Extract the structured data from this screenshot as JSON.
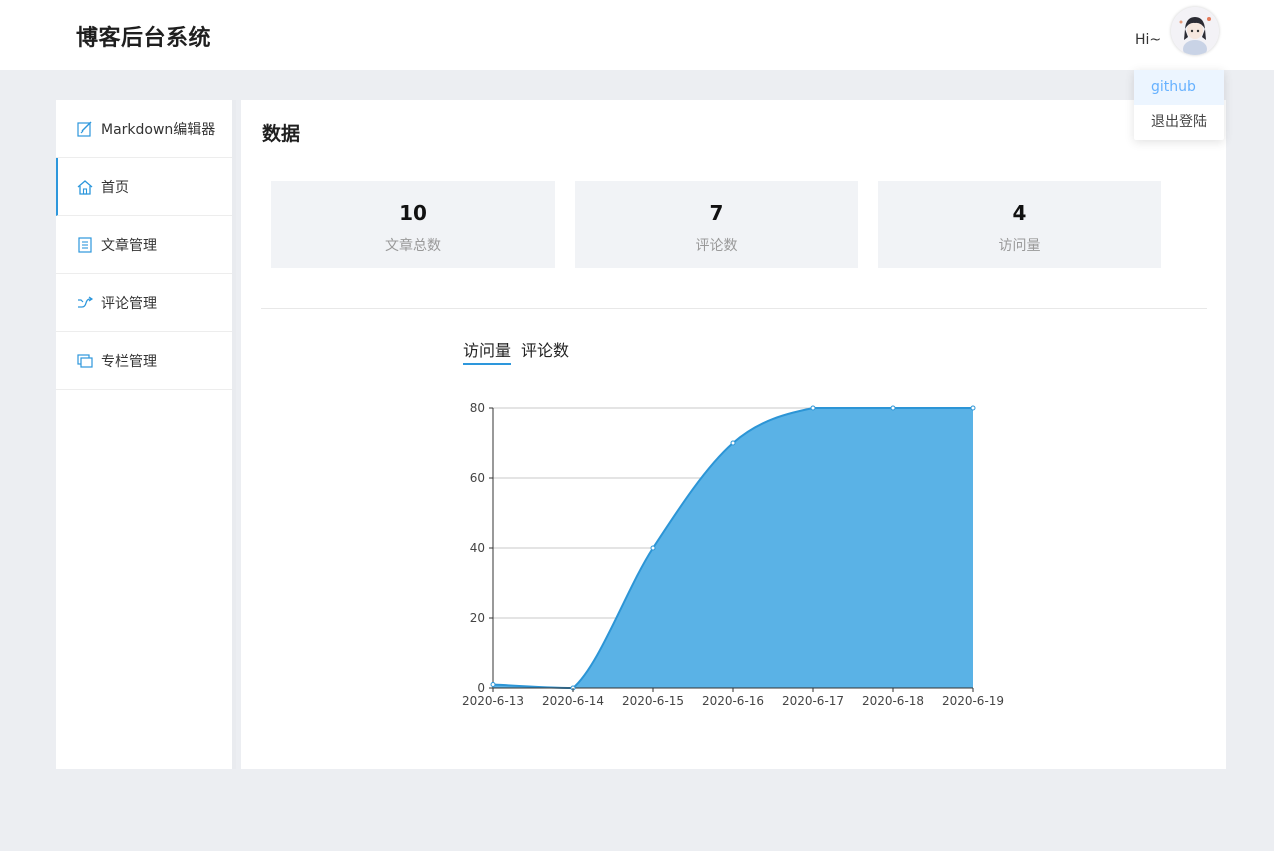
{
  "header": {
    "brand": "博客后台系统",
    "greeting": "Hi~"
  },
  "user_menu": {
    "items": [
      {
        "label": "github"
      },
      {
        "label": "退出登陆"
      }
    ]
  },
  "sidebar": {
    "items": [
      {
        "label": "Markdown编辑器",
        "icon": "edit-icon"
      },
      {
        "label": "首页",
        "icon": "home-icon"
      },
      {
        "label": "文章管理",
        "icon": "list-icon"
      },
      {
        "label": "评论管理",
        "icon": "shuffle-icon"
      },
      {
        "label": "专栏管理",
        "icon": "copy-icon"
      }
    ],
    "active_index": 1
  },
  "main": {
    "title": "数据",
    "stats": [
      {
        "value": "10",
        "label": "文章总数"
      },
      {
        "value": "7",
        "label": "评论数"
      },
      {
        "value": "4",
        "label": "访问量"
      }
    ],
    "tabs": [
      {
        "label": "访问量"
      },
      {
        "label": "评论数"
      }
    ],
    "active_tab": 0
  },
  "colors": {
    "accent": "#2d97dc",
    "area_fill": "#5ab2e6",
    "line": "#2c95d6"
  },
  "chart_data": {
    "type": "area",
    "x": [
      "2020-6-13",
      "2020-6-14",
      "2020-6-15",
      "2020-6-16",
      "2020-6-17",
      "2020-6-18",
      "2020-6-19"
    ],
    "series": [
      {
        "values": [
          1,
          0,
          40,
          70,
          80,
          80,
          80
        ]
      }
    ],
    "ylim": [
      0,
      80
    ],
    "yticks": [
      0,
      20,
      40,
      60,
      80
    ],
    "grid": true,
    "smooth": true
  }
}
